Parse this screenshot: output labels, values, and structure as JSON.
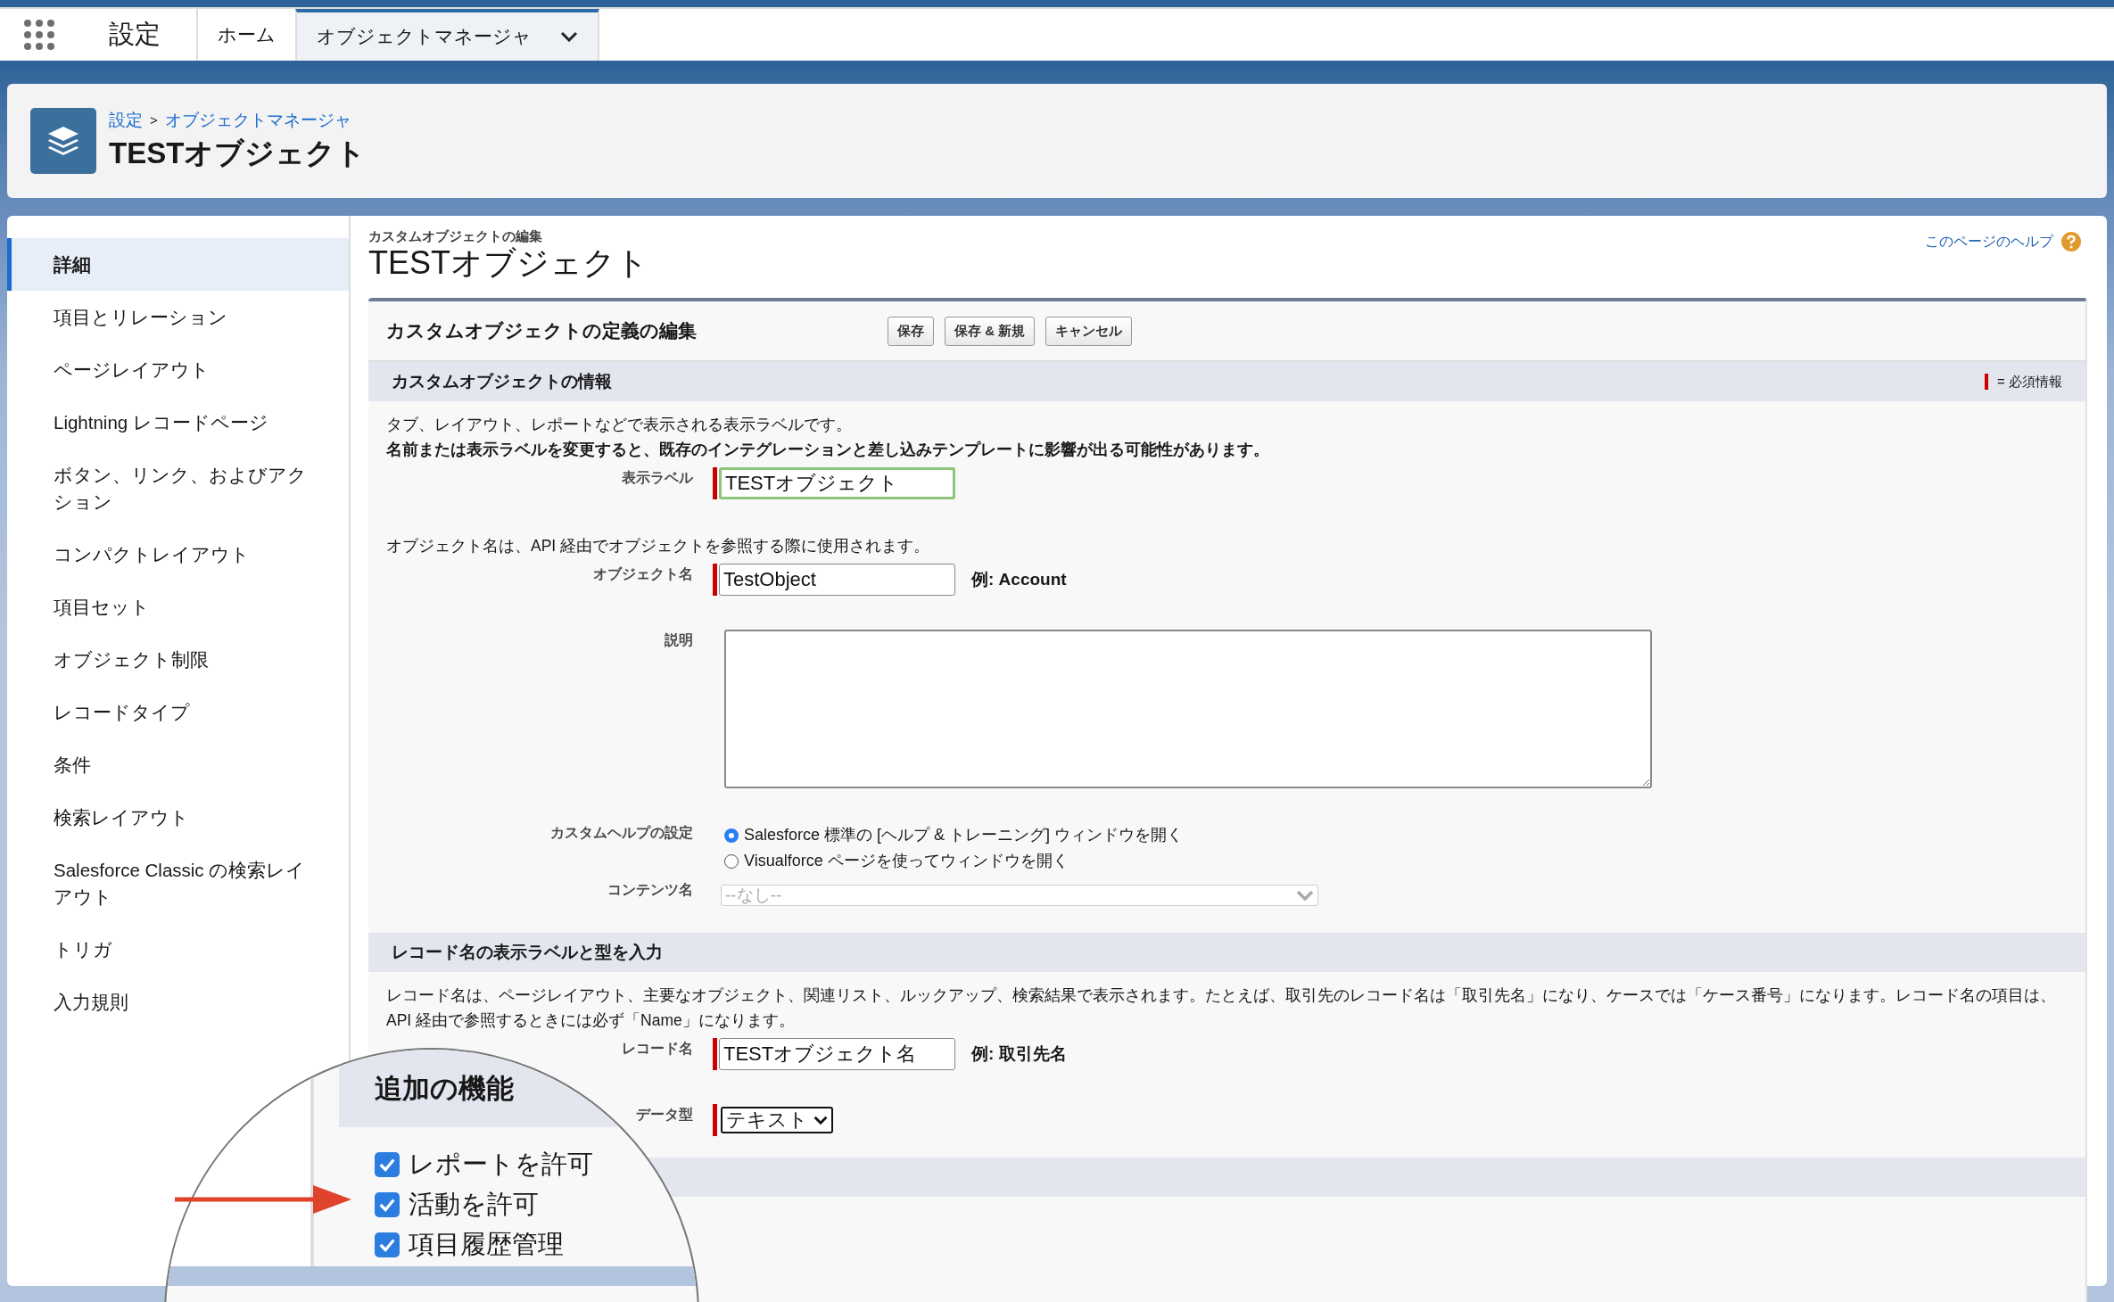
{
  "app": {
    "title": "設定"
  },
  "tabs": [
    {
      "label": "ホーム",
      "selected": false,
      "dropdown": false
    },
    {
      "label": "オブジェクトマネージャ",
      "selected": true,
      "dropdown": true
    }
  ],
  "header": {
    "breadcrumb": [
      "設定",
      "オブジェクトマネージャ"
    ],
    "separator": ">",
    "title": "TESTオブジェクト"
  },
  "sidebar": {
    "items": [
      {
        "label": "詳細",
        "selected": true
      },
      {
        "label": "項目とリレーション",
        "selected": false
      },
      {
        "label": "ページレイアウト",
        "selected": false
      },
      {
        "label": "Lightning レコードページ",
        "selected": false
      },
      {
        "label": "ボタン、リンク、およびアクション",
        "selected": false
      },
      {
        "label": "コンパクトレイアウト",
        "selected": false
      },
      {
        "label": "項目セット",
        "selected": false
      },
      {
        "label": "オブジェクト制限",
        "selected": false
      },
      {
        "label": "レコードタイプ",
        "selected": false
      },
      {
        "label": "条件",
        "selected": false
      },
      {
        "label": "検索レイアウト",
        "selected": false
      },
      {
        "label": "Salesforce Classic の検索レイアウト",
        "selected": false
      },
      {
        "label": "トリガ",
        "selected": false
      },
      {
        "label": "入力規則",
        "selected": false
      }
    ]
  },
  "page": {
    "caption": "カスタムオブジェクトの編集",
    "title": "TESTオブジェクト",
    "help_link": "このページのヘルプ"
  },
  "form": {
    "title": "カスタムオブジェクトの定義の編集",
    "buttons": [
      "保存",
      "保存 & 新規",
      "キャンセル"
    ],
    "required_legend": "= 必須情報",
    "sections": [
      {
        "title": "カスタムオブジェクトの情報",
        "rows": [
          {
            "kind": "note",
            "text": "タブ、レイアウト、レポートなどで表示される表示ラベルです。",
            "bold": false
          },
          {
            "kind": "note",
            "text": "名前または表示ラベルを変更すると、既存のインテグレーションと差し込みテンプレートに影響が出る可能性があります。",
            "bold": true
          },
          {
            "kind": "field",
            "label": "表示ラベル",
            "value": "TESTオブジェクト",
            "required": true,
            "focused": true
          },
          {
            "kind": "note",
            "text": "オブジェクト名は、API 経由でオブジェクトを参照する際に使用されます。",
            "bold": false
          },
          {
            "kind": "field",
            "label": "オブジェクト名",
            "value": "TestObject",
            "required": true,
            "focused": false,
            "example": "例:  Account"
          },
          {
            "kind": "textarea",
            "label": "説明"
          },
          {
            "kind": "radio",
            "label": "カスタムヘルプの設定",
            "options": [
              {
                "label": "Salesforce 標準の [ヘルプ & トレーニング] ウィンドウを開く",
                "selected": true
              },
              {
                "label": "Visualforce ページを使ってウィンドウを開く",
                "selected": false
              }
            ]
          },
          {
            "kind": "select",
            "label": "コンテンツ名",
            "value": "--なし--",
            "disabled": true,
            "required": false
          }
        ]
      },
      {
        "title": "レコード名の表示ラベルと型を入力",
        "rows": [
          {
            "kind": "note",
            "text": "レコード名は、ページレイアウト、主要なオブジェクト、関連リスト、ルックアップ、検索結果で表示されます。たとえば、取引先のレコード名は「取引先名」になり、ケースでは「ケース番号」になります。レコード名の項目は、API 経由で参照するときには必ず「Name」になります。",
            "bold": false
          },
          {
            "kind": "field",
            "label": "レコード名",
            "value": "TESTオブジェクト名",
            "required": true,
            "focused": false,
            "example": "例:  取引先名"
          },
          {
            "kind": "select",
            "label": "データ型",
            "value": "テキスト",
            "disabled": false,
            "required": true
          }
        ]
      }
    ]
  },
  "magnifier": {
    "title": "追加の機能",
    "checkboxes": [
      {
        "label": "レポートを許可",
        "checked": true
      },
      {
        "label": "活動を許可",
        "checked": true
      },
      {
        "label": "項目履歴管理",
        "checked": true
      }
    ]
  }
}
